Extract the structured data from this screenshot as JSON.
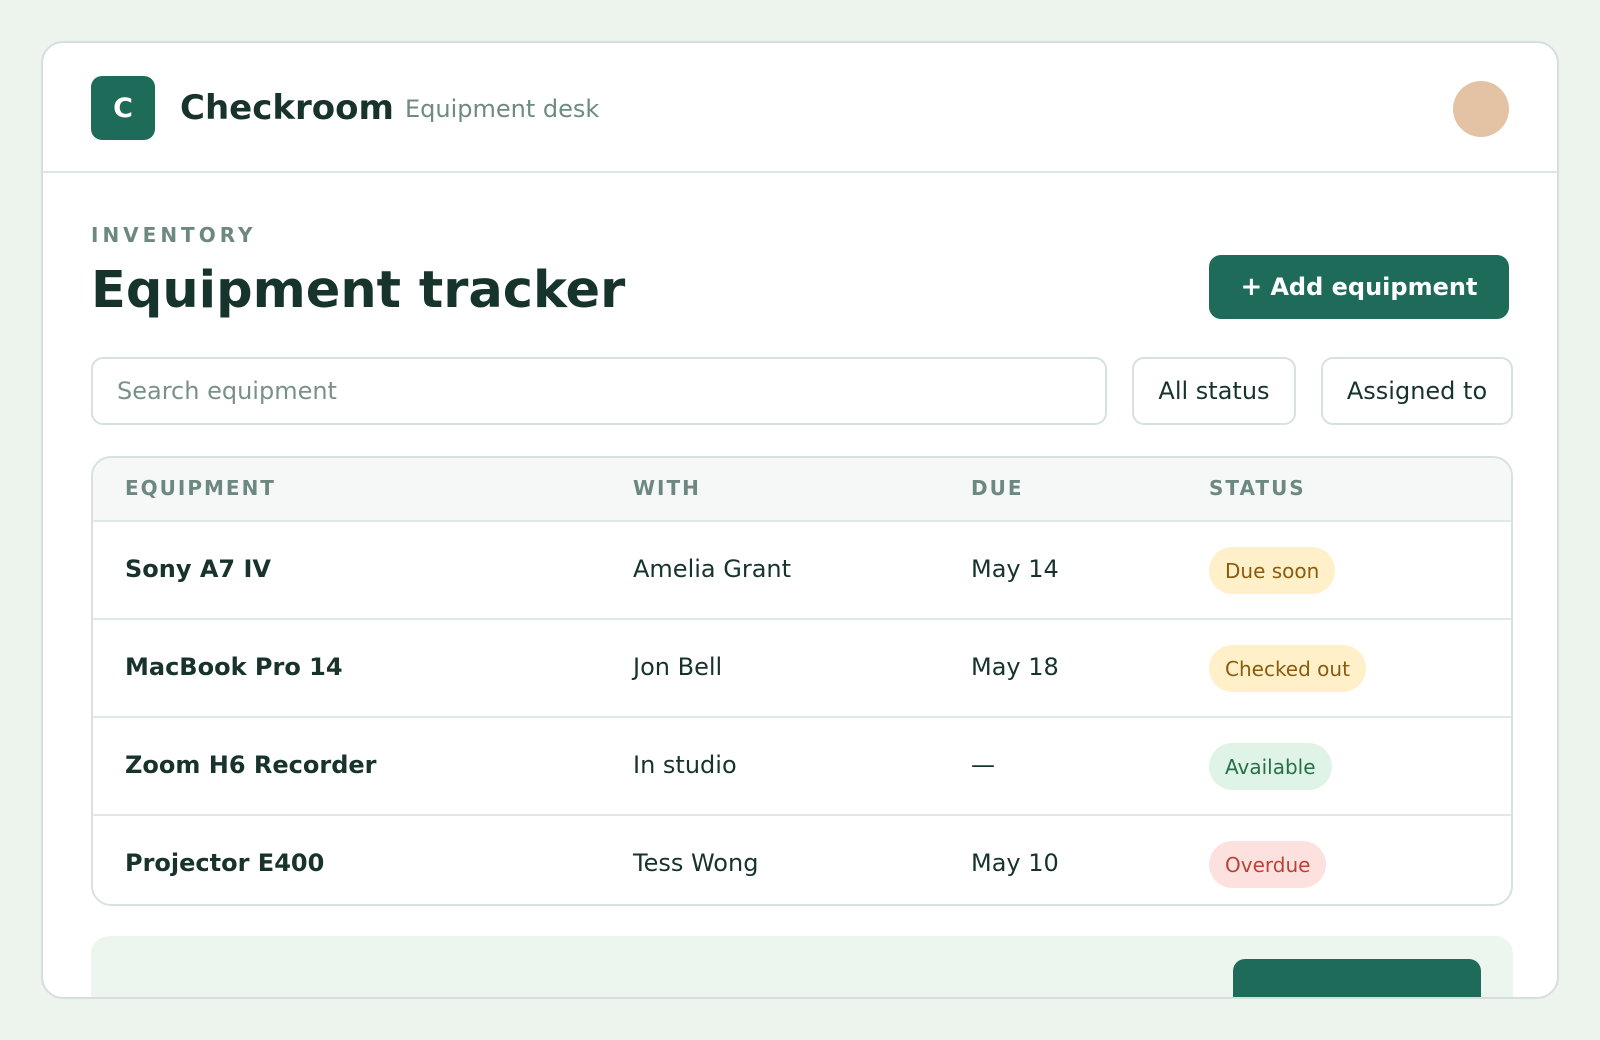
{
  "header": {
    "logo_letter": "C",
    "app_name": "Checkroom",
    "subtitle": "Equipment desk"
  },
  "main": {
    "eyebrow": "INVENTORY",
    "title": "Equipment tracker",
    "add_button_icon": "+",
    "add_button_label": "Add equipment",
    "search_placeholder": "Search equipment",
    "filters": {
      "status": "All status",
      "assigned": "Assigned to"
    }
  },
  "table": {
    "columns": [
      "EQUIPMENT",
      "WITH",
      "DUE",
      "STATUS"
    ],
    "rows": [
      {
        "equipment": "Sony A7 IV",
        "with": "Amelia Grant",
        "due": "May 14",
        "status": "Due soon"
      },
      {
        "equipment": "MacBook Pro 14",
        "with": "Jon Bell",
        "due": "May 18",
        "status": "Checked out"
      },
      {
        "equipment": "Zoom H6 Recorder",
        "with": "In studio",
        "due": "—",
        "status": "Available"
      },
      {
        "equipment": "Projector E400",
        "with": "Tess Wong",
        "due": "May 10",
        "status": "Overdue"
      }
    ]
  },
  "icons": {
    "add": "plus-icon",
    "logo": "logo-letter-icon",
    "avatar": "user-avatar"
  },
  "colors": {
    "accent": "#1f6b5a",
    "background": "#edf4ee",
    "warning_badge_bg": "#fff0c9",
    "warning_badge_text": "#8a5a0d",
    "success_badge_bg": "#dff3e6",
    "success_badge_text": "#277048",
    "danger_badge_bg": "#fde1df",
    "danger_badge_text": "#b84438"
  }
}
